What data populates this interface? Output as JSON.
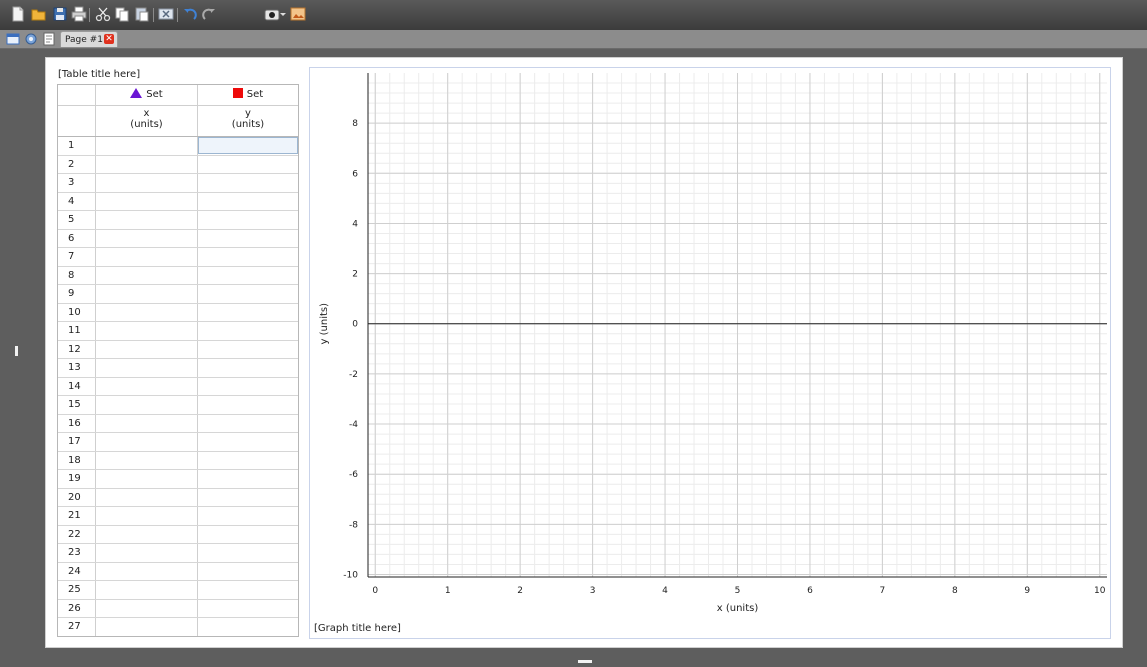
{
  "app": {
    "toolbar": {
      "icons": [
        "new-file-icon",
        "open-folder-icon",
        "save-icon",
        "print-icon",
        "cut-icon",
        "copy-icon",
        "paste-icon",
        "delete-icon",
        "undo-icon",
        "redo-icon",
        "camera-icon",
        "dropdown-arrow-icon",
        "image-icon"
      ]
    },
    "tabbar": {
      "icons": [
        "window-icon",
        "settings-icon",
        "document-icon"
      ],
      "tab_label": "Page #1",
      "close_glyph": "✕"
    }
  },
  "table": {
    "title": "[Table title here]",
    "columns": [
      {
        "set_label": "Set",
        "symbol": "triangle",
        "color": "#6a16d4",
        "var": "x",
        "units": "(units)"
      },
      {
        "set_label": "Set",
        "symbol": "square",
        "color": "#ee0a0a",
        "var": "y",
        "units": "(units)"
      }
    ],
    "row_numbers": [
      "1",
      "2",
      "3",
      "4",
      "5",
      "6",
      "7",
      "8",
      "9",
      "10",
      "11",
      "12",
      "13",
      "14",
      "15",
      "16",
      "17",
      "18",
      "19",
      "20",
      "21",
      "22",
      "23",
      "24",
      "25",
      "26",
      "27"
    ]
  },
  "graph": {
    "title": "[Graph title here]"
  },
  "chart_data": {
    "type": "scatter",
    "title": "",
    "xlabel": "x (units)",
    "ylabel": "y (units)",
    "xlim": [
      -0.1,
      10.1
    ],
    "ylim": [
      -10.1,
      10
    ],
    "xticks": [
      0,
      1,
      2,
      3,
      4,
      5,
      6,
      7,
      8,
      9,
      10
    ],
    "yticks": [
      -10,
      -8,
      -6,
      -4,
      -2,
      0,
      2,
      4,
      6,
      8
    ],
    "grid": true,
    "series": []
  }
}
